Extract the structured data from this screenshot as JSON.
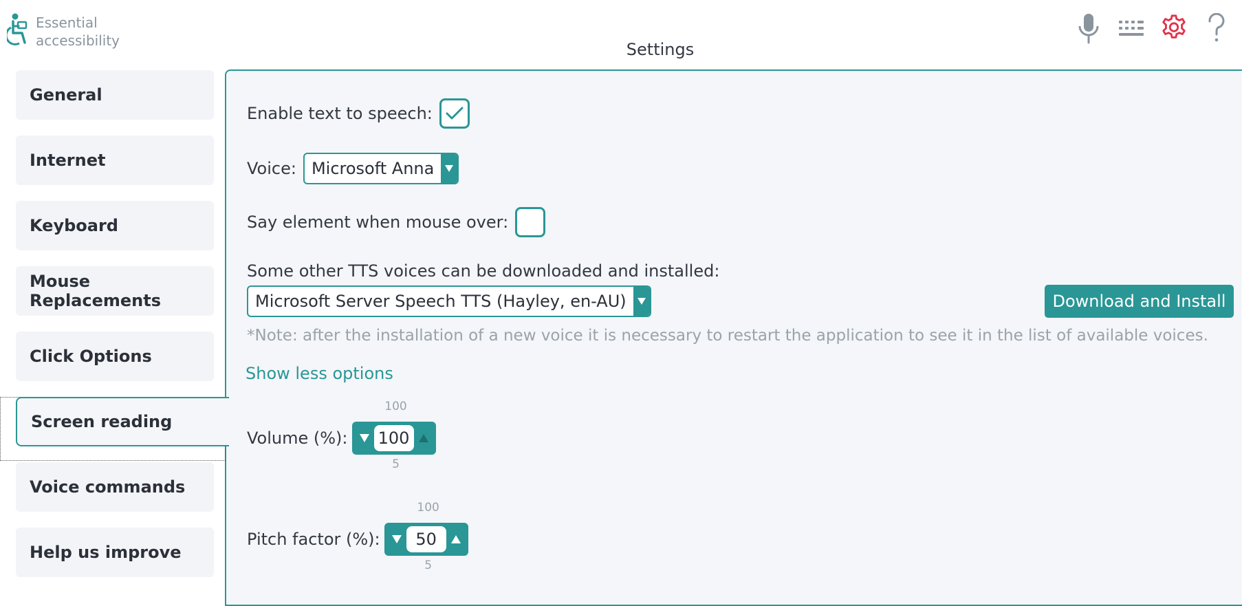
{
  "header": {
    "logo_line1": "Essential",
    "logo_line2": "accessibility",
    "title": "Settings",
    "icons": [
      "microphone-icon",
      "keyboard-icon",
      "gear-icon",
      "help-icon"
    ],
    "accent_color": "#2a9696",
    "active_icon_color": "#e0334a"
  },
  "sidebar": {
    "items": [
      {
        "label": "General"
      },
      {
        "label": "Internet"
      },
      {
        "label": "Keyboard"
      },
      {
        "label": "Mouse Replacements"
      },
      {
        "label": "Click Options"
      },
      {
        "label": "Screen reading",
        "active": true
      },
      {
        "label": "Voice commands"
      },
      {
        "label": "Help us improve"
      }
    ]
  },
  "screen_reading": {
    "tts_label": "Enable text to speech:",
    "tts_checked": true,
    "voice_label": "Voice:",
    "voice_value": "Microsoft Anna",
    "mouse_over_label": "Say element when mouse over:",
    "mouse_over_checked": false,
    "other_voices_label": "Some other TTS voices can be downloaded and installed:",
    "other_voices_value": "Microsoft Server Speech TTS (Hayley, en-AU)",
    "download_button": "Download and Install",
    "note": "*Note: after the installation of a new voice it is necessary to restart the application to see it in the list of available voices.",
    "toggle_link": "Show less options",
    "volume": {
      "label": "Volume (%):",
      "value": "100",
      "max": "100",
      "min": "5"
    },
    "pitch": {
      "label": "Pitch factor (%):",
      "value": "50",
      "max": "100",
      "min": "5"
    }
  }
}
